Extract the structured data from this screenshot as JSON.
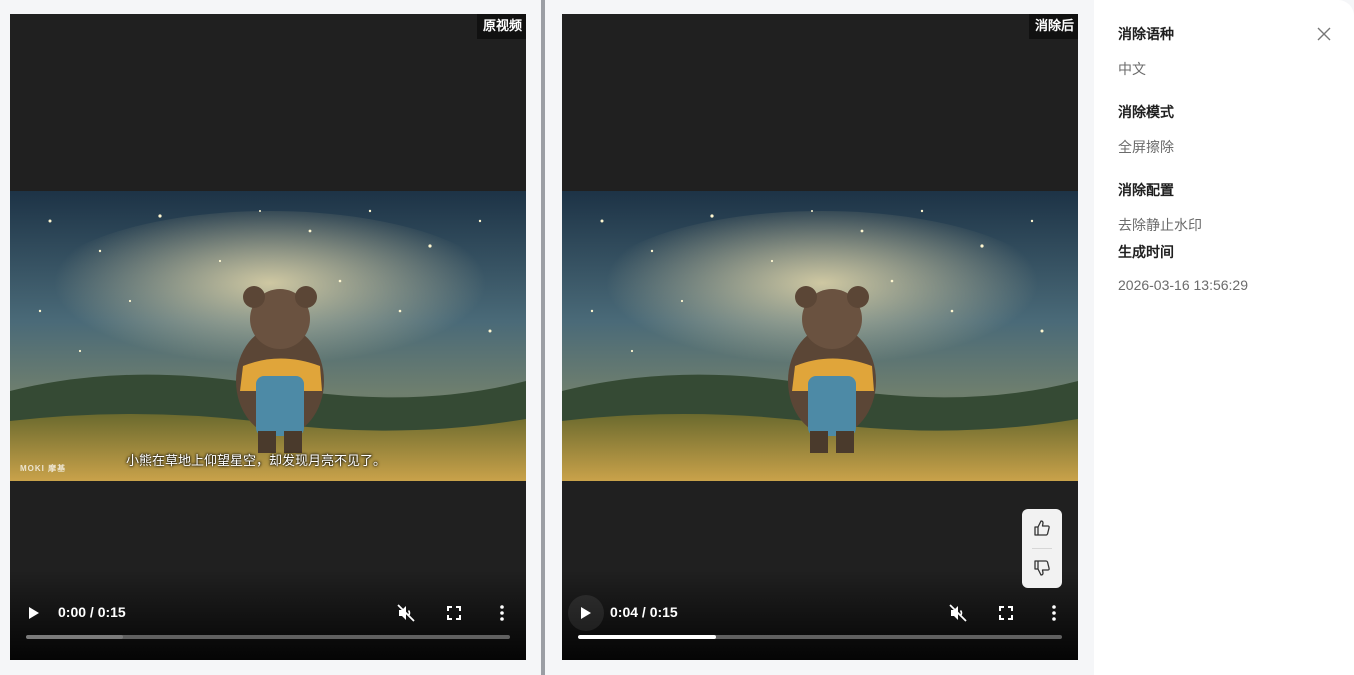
{
  "left_player": {
    "label": "原视频",
    "subtitle": "小熊在草地上仰望星空，却发现月亮不见了。",
    "watermark": "MOKI 摩基",
    "time": "0:00 / 0:15",
    "progress": 0.2,
    "progress_color": "#7b7b7b"
  },
  "right_player": {
    "label": "消除后",
    "time": "0:04 / 0:15",
    "progress": 0.285,
    "progress_color": "#ffffff"
  },
  "icons": {
    "play": "play-icon",
    "mute": "volume-muted-icon",
    "fullscreen": "fullscreen-icon",
    "more": "more-vertical-icon",
    "like": "thumbs-up-icon",
    "dislike": "thumbs-down-icon",
    "close": "close-icon"
  },
  "details": {
    "language_title": "消除语种",
    "language_value": "中文",
    "mode_title": "消除模式",
    "mode_value": "全屏擦除",
    "config_title": "消除配置",
    "config_value": "去除静止水印",
    "time_title": "生成时间",
    "time_value": "2026-03-16 13:56:29"
  }
}
